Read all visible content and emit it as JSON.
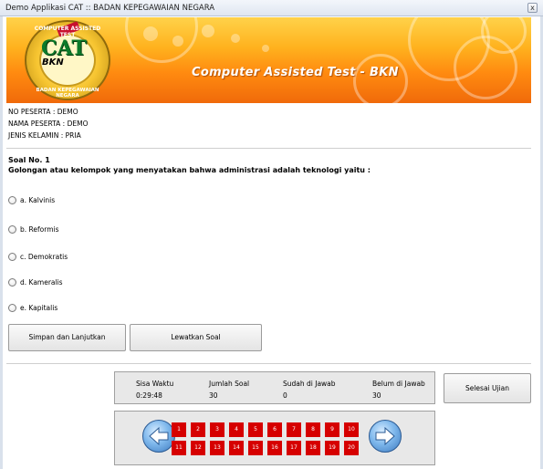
{
  "window": {
    "title": "Demo Applikasi CAT :: BADAN KEPEGAWAIAN NEGARA",
    "close_glyph": "x"
  },
  "banner": {
    "text": "Computer Assisted Test - BKN",
    "logo": {
      "main": "CAT",
      "sub": "BKN",
      "arc_top": "COMPUTER ASSISTED TEST",
      "arc_bottom": "BADAN KEPEGAWAIAN NEGARA"
    }
  },
  "participant": {
    "no_peserta": "NO PESERTA :  DEMO",
    "nama_peserta": "NAMA PESERTA : DEMO",
    "jenis_kelamin": "JENIS KELAMIN : PRIA"
  },
  "question": {
    "number": "Soal No. 1",
    "text": "Golongan atau kelompok yang menyatakan bahwa administrasi adalah teknologi yaitu :",
    "options": [
      "a. Kalvinis",
      "b. Reformis",
      "c. Demokratis",
      "d. Kameralis",
      "e. Kapitalis"
    ]
  },
  "actions": {
    "save_next": "Simpan dan Lanjutkan",
    "skip": "Lewatkan Soal",
    "finish": "Selesai Ujian"
  },
  "status": {
    "time_label": "Sisa Waktu",
    "time_value": "0:29:48",
    "total_label": "Jumlah Soal",
    "total_value": "30",
    "answered_label": "Sudah di Jawab",
    "answered_value": "0",
    "unanswered_label": "Belum di Jawab",
    "unanswered_value": "30"
  },
  "navigator": {
    "top_row": [
      "1",
      "2",
      "3",
      "4",
      "5",
      "6",
      "7",
      "8",
      "9",
      "10"
    ],
    "bottom_row": [
      "11",
      "12",
      "13",
      "14",
      "15",
      "16",
      "17",
      "18",
      "19",
      "20"
    ],
    "cell_color": "#d60000",
    "prev_icon": "arrow-left-icon",
    "next_icon": "arrow-right-icon"
  }
}
